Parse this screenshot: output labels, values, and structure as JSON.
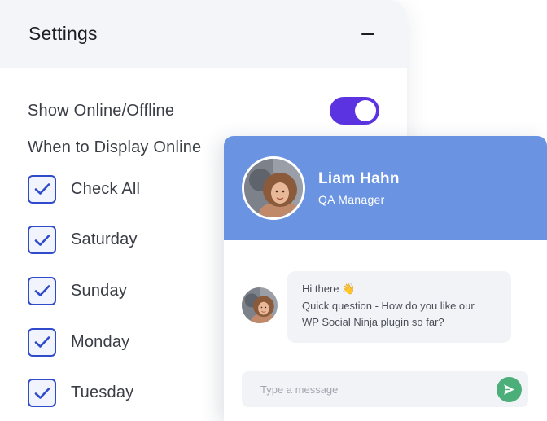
{
  "settings": {
    "title": "Settings",
    "show_online_label": "Show Online/Offline",
    "show_online_enabled": true,
    "display_label": "When to Display Online",
    "days": [
      {
        "label": "Check All",
        "checked": true
      },
      {
        "label": "Saturday",
        "checked": true
      },
      {
        "label": "Sunday",
        "checked": true
      },
      {
        "label": "Monday",
        "checked": true
      },
      {
        "label": "Tuesday",
        "checked": true
      }
    ]
  },
  "chat": {
    "agent_name": "Liam Hahn",
    "agent_role": "QA Manager",
    "message": {
      "line1": "Hi there 👋",
      "line2": "Quick question - How do you like our",
      "line3": "WP Social Ninja plugin so far?"
    },
    "input_placeholder": "Type a message"
  },
  "colors": {
    "toggle_accent": "#5b33e0",
    "checkbox_border": "#2f4bc9",
    "chat_header": "#6a93e2",
    "send_button": "#4caf7a"
  },
  "icons": {
    "collapse": "minus-icon",
    "checkbox": "checkmark-icon",
    "send": "paper-plane-send-icon"
  }
}
